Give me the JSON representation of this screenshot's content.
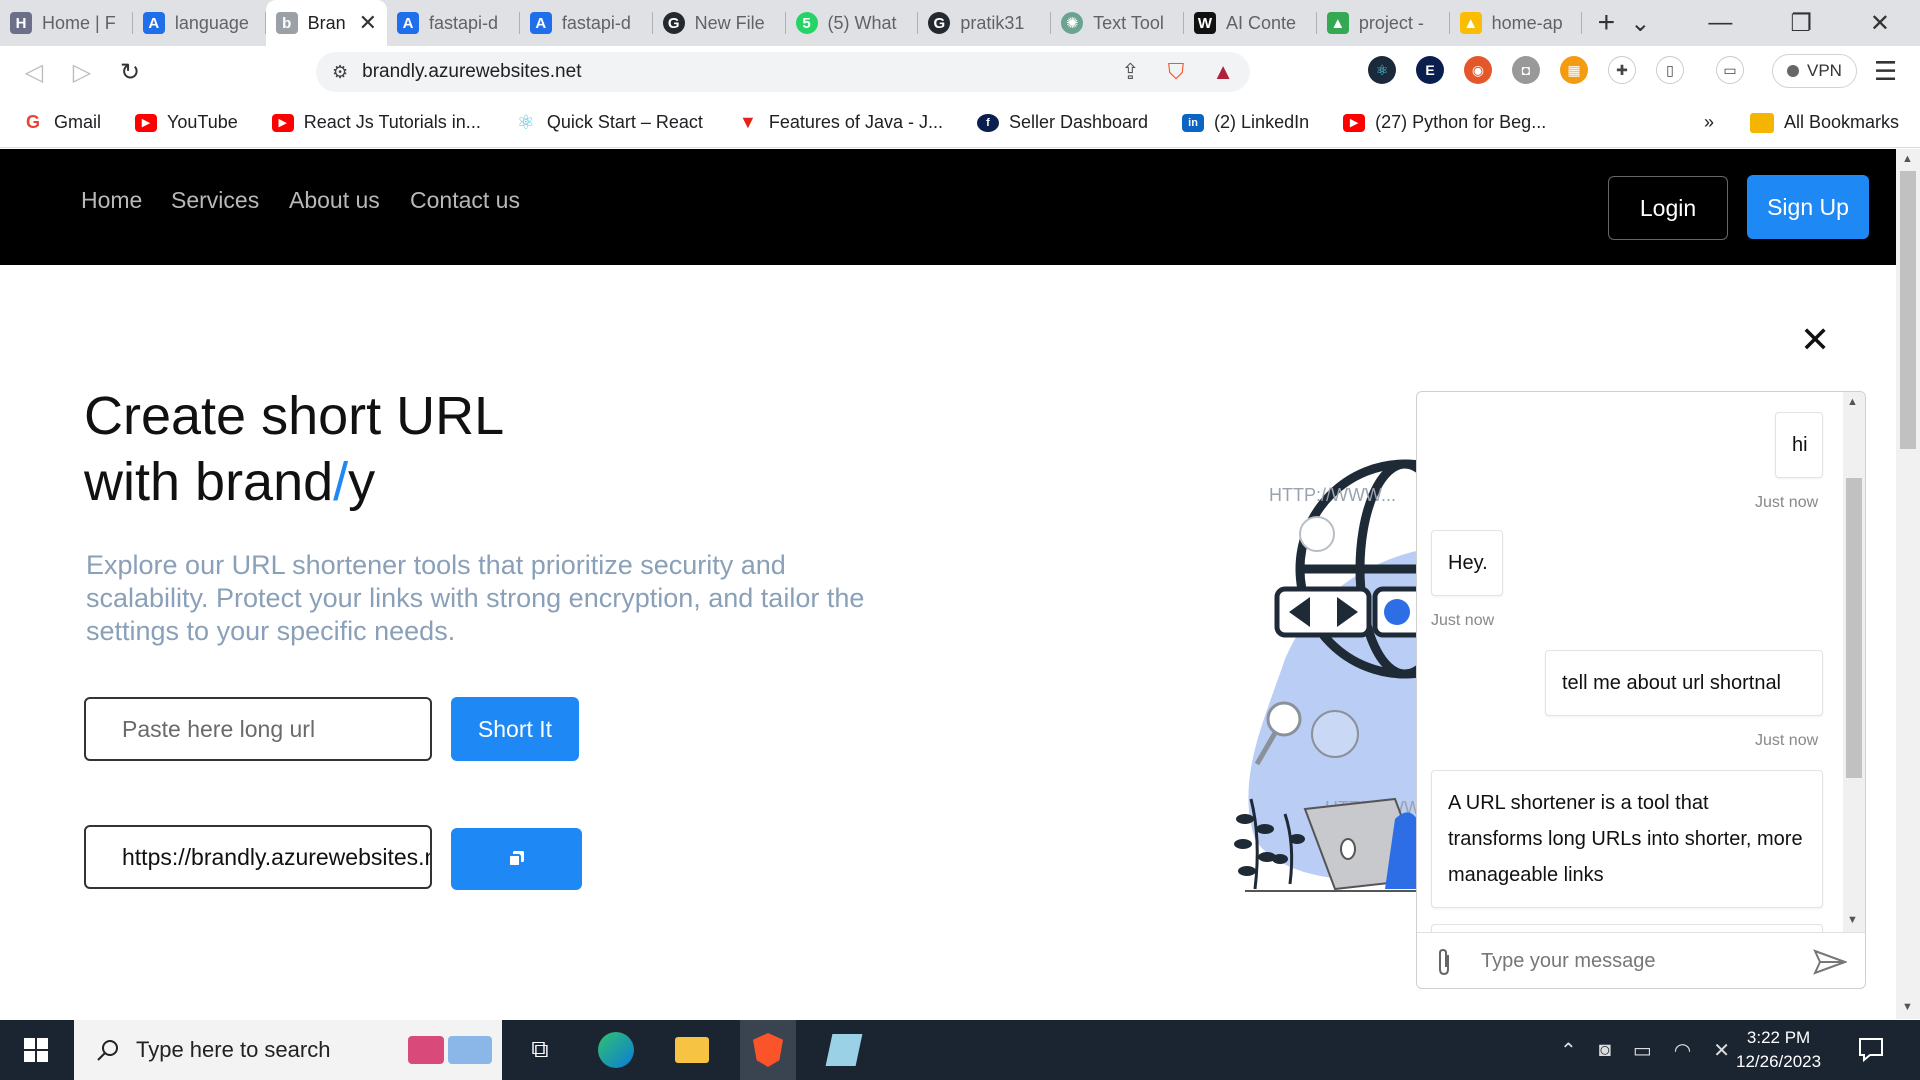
{
  "browser": {
    "tabs": [
      {
        "label": "Home | F",
        "icon_color": "#6b6f8a",
        "glyph": "H"
      },
      {
        "label": "language",
        "icon_color": "#1f6feb",
        "glyph": "A"
      },
      {
        "label": "Bran",
        "icon_color": "#9aa0a6",
        "glyph": "b",
        "active": true
      },
      {
        "label": "fastapi-d",
        "icon_color": "#1f6feb",
        "glyph": "A"
      },
      {
        "label": "fastapi-d",
        "icon_color": "#1f6feb",
        "glyph": "A"
      },
      {
        "label": "New File",
        "icon_color": "#24292f",
        "glyph": "G"
      },
      {
        "label": "(5) What",
        "icon_color": "#25d366",
        "glyph": "5"
      },
      {
        "label": "pratik31",
        "icon_color": "#24292f",
        "glyph": "G"
      },
      {
        "label": "Text Tool",
        "icon_color": "#6aa38f",
        "glyph": "✺"
      },
      {
        "label": "AI Conte",
        "icon_color": "#111111",
        "glyph": "W"
      },
      {
        "label": "project -",
        "icon_color": "#34a853",
        "glyph": "▲"
      },
      {
        "label": "home-ap",
        "icon_color": "#fbbc04",
        "glyph": "▲"
      }
    ],
    "new_tab_symbol": "+",
    "address": "brandly.azurewebsites.net",
    "vpn_label": "VPN",
    "bookmarks": [
      {
        "label": "Gmail",
        "color": "#ea4335",
        "glyph": "G"
      },
      {
        "label": "YouTube",
        "color": "#ff0000",
        "glyph": "▶"
      },
      {
        "label": "React Js Tutorials in...",
        "color": "#ff0000",
        "glyph": "▶"
      },
      {
        "label": "Quick Start – React",
        "color": "#58c4dc",
        "glyph": "⚛"
      },
      {
        "label": "Features of Java - J...",
        "color": "#e62117",
        "glyph": "▼"
      },
      {
        "label": "Seller Dashboard",
        "color": "#0b1f4f",
        "glyph": "f"
      },
      {
        "label": "(2) LinkedIn",
        "color": "#0a66c2",
        "glyph": "in"
      },
      {
        "label": "(27) Python for Beg...",
        "color": "#ff0000",
        "glyph": "▶"
      }
    ],
    "overflow_label": "»",
    "all_bookmarks": "All Bookmarks"
  },
  "nav": {
    "links": [
      "Home",
      "Services",
      "About us",
      "Contact us"
    ],
    "login": "Login",
    "signup": "Sign Up"
  },
  "hero": {
    "title_line1": "Create short URL",
    "title_line2_pre": "with brand",
    "title_slash": "/",
    "title_line2_post": "y",
    "description": "Explore our URL shortener tools that prioritize security and scalability. Protect your links with strong encryption, and tailor the settings to your specific needs.",
    "input_placeholder": "Paste here long url",
    "short_button": "Short It",
    "result_value": "https://brandly.azurewebsites.net"
  },
  "illustration": {
    "text1": "HTTP://WWW...",
    "text2": "HTTP://WWW"
  },
  "chat": {
    "messages": [
      {
        "from": "user",
        "text": "hi",
        "time": "Just now"
      },
      {
        "from": "bot",
        "text": "Hey.",
        "time": "Just now"
      },
      {
        "from": "user",
        "text": "tell me about url shortnal",
        "time": "Just now"
      },
      {
        "from": "bot",
        "text": "A URL shortener is a tool that transforms long URLs into shorter, more manageable links"
      }
    ],
    "input_placeholder": "Type your message"
  },
  "taskbar": {
    "search_placeholder": "Type here to search",
    "time": "3:22 PM",
    "date": "12/26/2023"
  },
  "colors": {
    "accent": "#1e88f5",
    "nav_bg": "#000000",
    "desc_text": "#8aa0b8"
  }
}
